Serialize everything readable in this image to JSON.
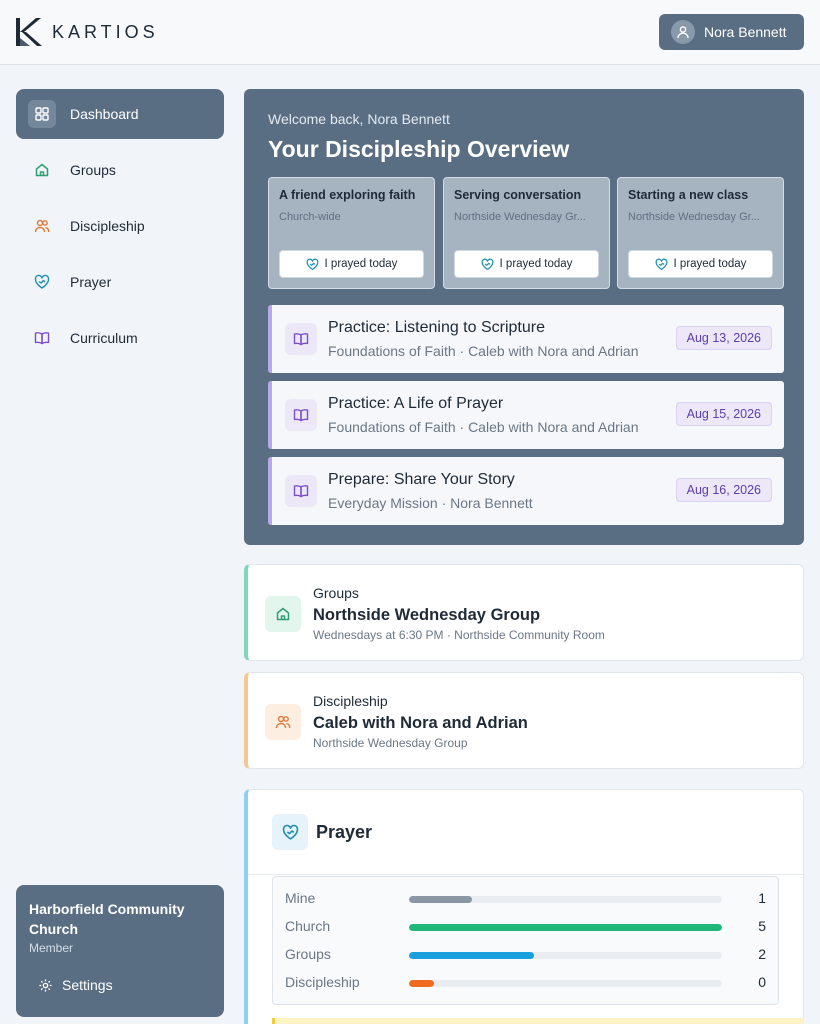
{
  "header": {
    "brand": "KARTIOS",
    "user_name": "Nora Bennett"
  },
  "sidebar": {
    "items": [
      {
        "label": "Dashboard",
        "icon": "dashboard-icon",
        "active": true
      },
      {
        "label": "Groups",
        "icon": "house-icon",
        "color": "#2f9e72"
      },
      {
        "label": "Discipleship",
        "icon": "people-icon",
        "color": "#e07a3b"
      },
      {
        "label": "Prayer",
        "icon": "heart-handshake-icon",
        "color": "#1f8fb0"
      },
      {
        "label": "Curriculum",
        "icon": "book-icon",
        "color": "#7b4fc9"
      }
    ],
    "church": {
      "name": "Harborfield Community Church",
      "role": "Member",
      "settings_label": "Settings"
    }
  },
  "overview": {
    "welcome": "Welcome back, Nora Bennett",
    "title": "Your Discipleship Overview",
    "requests": [
      {
        "title": "A friend exploring faith",
        "scope": "Church-wide",
        "button": "I prayed today"
      },
      {
        "title": "Serving conversation",
        "scope": "Northside Wednesday Gr...",
        "button": "I prayed today"
      },
      {
        "title": "Starting a new class",
        "scope": "Northside Wednesday Gr...",
        "button": "I prayed today"
      }
    ],
    "items": [
      {
        "title": "Practice: Listening to Scripture",
        "subtitle": "Foundations of Faith · Caleb with Nora and Adrian",
        "date": "Aug 13, 2026"
      },
      {
        "title": "Practice: A Life of Prayer",
        "subtitle": "Foundations of Faith · Caleb with Nora and Adrian",
        "date": "Aug 15, 2026"
      },
      {
        "title": "Prepare: Share Your Story",
        "subtitle": "Everyday Mission · Nora Bennett",
        "date": "Aug 16, 2026"
      }
    ]
  },
  "groups_card": {
    "category": "Groups",
    "title": "Northside Wednesday Group",
    "subtitle": "Wednesdays at 6:30 PM · Northside Community Room"
  },
  "discipleship_card": {
    "category": "Discipleship",
    "title": "Caleb with Nora and Adrian",
    "subtitle": "Northside Wednesday Group"
  },
  "prayer": {
    "title": "Prayer",
    "stats": [
      {
        "label": "Mine",
        "count": "1",
        "fill": 0.2,
        "color": "#8a96a3"
      },
      {
        "label": "Church",
        "count": "5",
        "fill": 1.0,
        "color": "#1fb87a"
      },
      {
        "label": "Groups",
        "count": "2",
        "fill": 0.4,
        "color": "#1a9fde"
      },
      {
        "label": "Discipleship",
        "count": "0",
        "fill": 0.08,
        "color": "#f06b1f"
      }
    ]
  }
}
